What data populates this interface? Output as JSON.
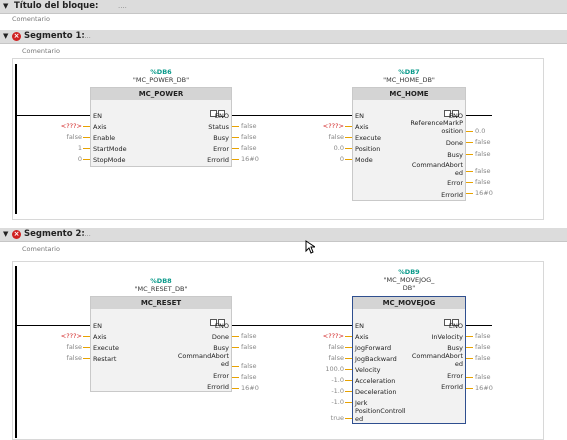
{
  "header": {
    "title": "Título del bloque:",
    "dots": "....",
    "comment": "Comentario"
  },
  "segment1": {
    "title": "Segmento 1:",
    "dots": "....",
    "comment": "Comentario",
    "power": {
      "db_number": "%DB6",
      "db_instance": "\"MC_POWER_DB\"",
      "name": "MC_POWER",
      "left_pins": [
        "EN",
        "Axis",
        "Enable",
        "StartMode",
        "StopMode"
      ],
      "left_values": [
        "",
        "<???>",
        "false",
        "1",
        "0"
      ],
      "right_pins": [
        "ENO",
        "Status",
        "Busy",
        "Error",
        "ErrorId"
      ],
      "right_values": [
        "",
        "false",
        "false",
        "false",
        "16#0"
      ]
    },
    "home": {
      "db_number": "%DB7",
      "db_instance": "\"MC_HOME_DB\"",
      "name": "MC_HOME",
      "left_pins": [
        "EN",
        "Axis",
        "Execute",
        "Position",
        "Mode"
      ],
      "left_values": [
        "",
        "<???>",
        "false",
        "0.0",
        "0"
      ],
      "right_pins": [
        "ENO",
        "ReferenceMarkP\nosition",
        "Done",
        "Busy",
        "CommandAbort\ned",
        "Error",
        "ErrorId"
      ],
      "right_values": [
        "",
        "0.0",
        "false",
        "false",
        "false",
        "false",
        "16#0"
      ]
    }
  },
  "segment2": {
    "title": "Segmento 2:",
    "dots": "....",
    "comment": "Comentario",
    "reset": {
      "db_number": "%DB8",
      "db_instance": "\"MC_RESET_DB\"",
      "name": "MC_RESET",
      "left_pins": [
        "EN",
        "Axis",
        "Execute",
        "Restart"
      ],
      "left_values": [
        "",
        "<???>",
        "false",
        "false"
      ],
      "right_pins": [
        "ENO",
        "Done",
        "Busy",
        "CommandAbort\ned",
        "Error",
        "ErrorId"
      ],
      "right_values": [
        "",
        "false",
        "false",
        "false",
        "false",
        "16#0"
      ]
    },
    "jog": {
      "db_number": "%DB9",
      "db_instance": "\"MC_MOVEJOG_\nDB\"",
      "name": "MC_MOVEJOG",
      "left_pins": [
        "EN",
        "Axis",
        "JogForward",
        "JogBackward",
        "Velocity",
        "Acceleration",
        "Deceleration",
        "Jerk",
        "PositionControll\ned"
      ],
      "left_values": [
        "",
        "<???>",
        "false",
        "false",
        "100.0",
        "-1.0",
        "-1.0",
        "-1.0",
        "true"
      ],
      "right_pins": [
        "ENO",
        "InVelocity",
        "Busy",
        "CommandAbort\ned",
        "Error",
        "ErrorId"
      ],
      "right_values": [
        "",
        "false",
        "false",
        "false",
        "false",
        "16#0"
      ]
    }
  }
}
